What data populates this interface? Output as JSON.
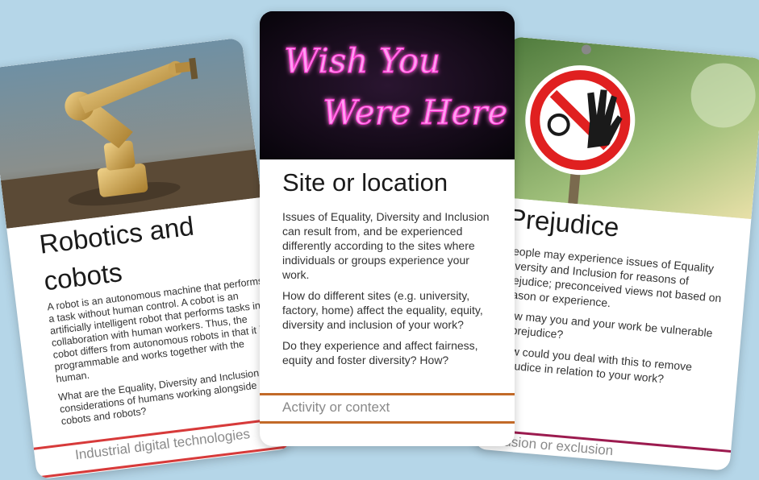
{
  "cards": [
    {
      "title": "Robotics and cobots",
      "paragraphs": [
        "A robot is an autonomous machine that performs a task without human control. A cobot is an artificially intelligent robot that performs tasks in collaboration with human workers. Thus, the cobot differs from autonomous robots in that it is programmable and works together with the human.",
        "What are the Equality, Diversity and Inclusion considerations of humans working alongside cobots and robots?"
      ],
      "footer": "Industrial digital technologies",
      "accent": "#d73a3a",
      "image": "robot-arm-image"
    },
    {
      "title": "Site or location",
      "neon_line1": "Wish You",
      "neon_line2": "Were Here",
      "paragraphs": [
        "Issues of Equality, Diversity and Inclusion can result from, and be experienced differently according to the sites where individuals or groups experience your work.",
        "How do different sites (e.g. university, factory, home) affect the equality, equity, diversity and inclusion of your work?",
        "Do they experience and affect fairness, equity and foster diversity? How?"
      ],
      "footer": "Activity or context",
      "accent": "#c26a28",
      "image": "neon-sign-image"
    },
    {
      "title": "Prejudice",
      "paragraphs": [
        "People may experience issues of Equality Diversity and Inclusion for reasons of prejudice; preconceived views not based on reason or experience.",
        "How may you and your work be vulnerable to prejudice?",
        "How could you deal with this to remove prejudice in relation to your work?"
      ],
      "footer": "Inclusion or exclusion",
      "accent": "#9c1b4f",
      "image": "no-entry-sign-image"
    }
  ]
}
